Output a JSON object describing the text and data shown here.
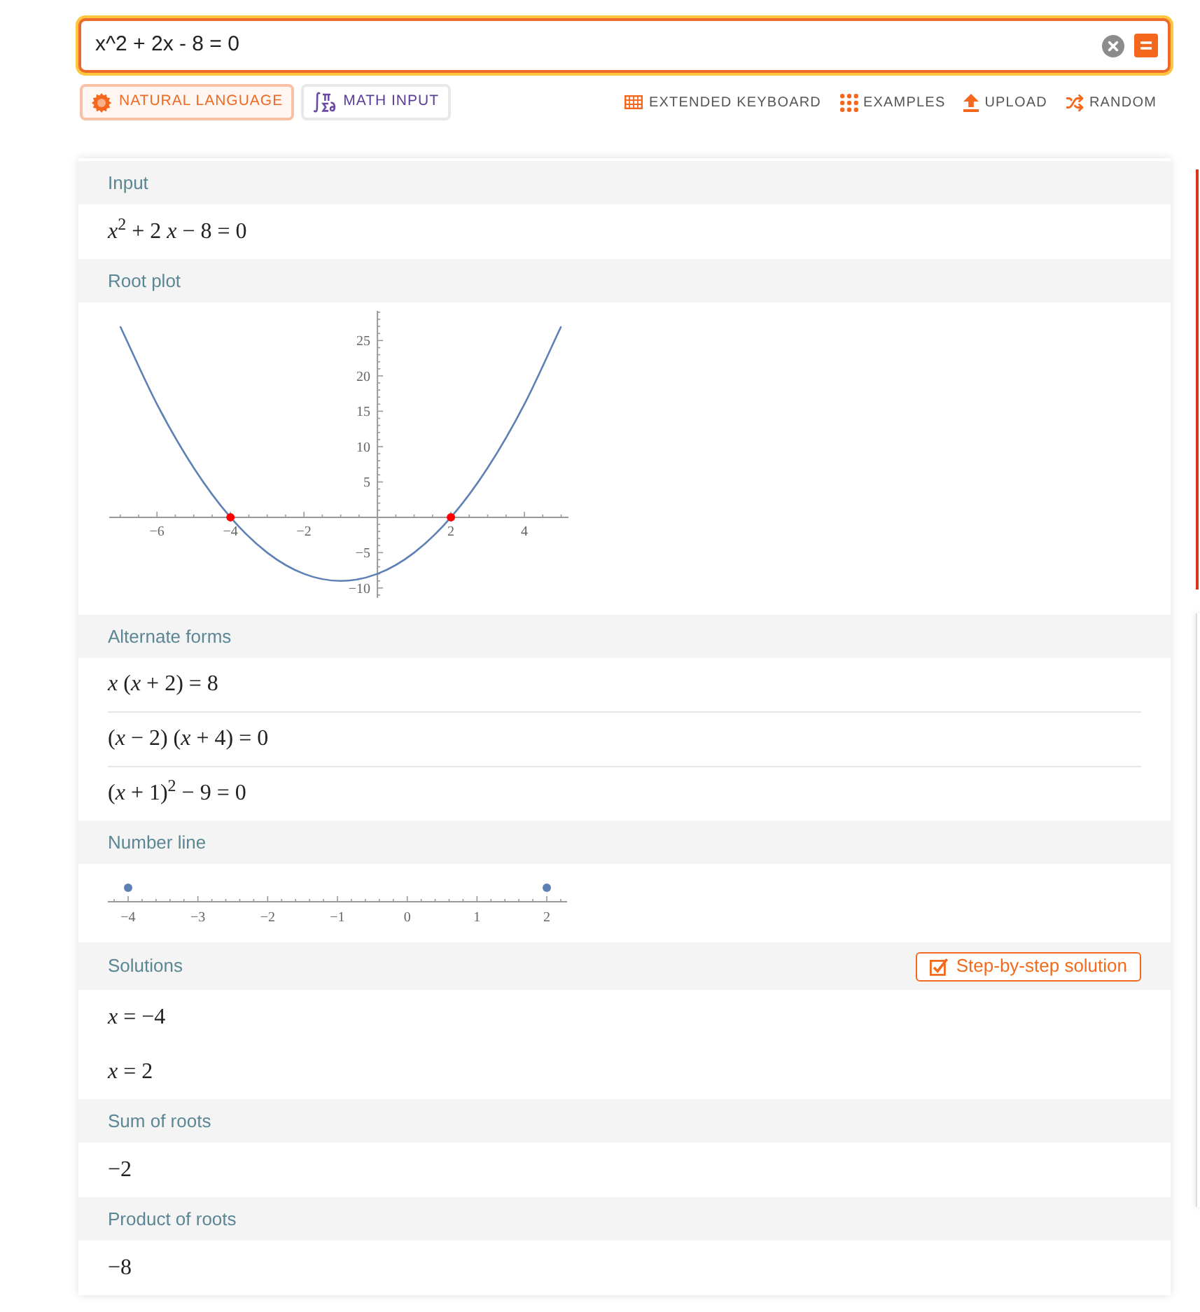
{
  "search": {
    "value": "x^2 + 2x - 8 = 0"
  },
  "input_modes": [
    {
      "label": "NATURAL LANGUAGE",
      "kind": "natural",
      "selected": true
    },
    {
      "label": "MATH INPUT",
      "kind": "math",
      "selected": false
    }
  ],
  "tools": [
    {
      "label": "EXTENDED KEYBOARD",
      "kind": "keyboard"
    },
    {
      "label": "EXAMPLES",
      "kind": "examples"
    },
    {
      "label": "UPLOAD",
      "kind": "upload"
    },
    {
      "label": "RANDOM",
      "kind": "random"
    }
  ],
  "pods": [
    {
      "title": "Input",
      "kind": "math",
      "rows": [
        "*x*$^{2}$ + 2 *x* − 8 = 0"
      ]
    },
    {
      "title": "Root plot",
      "kind": "plot",
      "chart_data": {
        "type": "line",
        "x": [
          -7,
          -6,
          -5,
          -4,
          -3,
          -2,
          -1,
          0,
          1,
          2,
          3,
          4,
          5
        ],
        "series": [
          {
            "color": "#5e81b5",
            "values": [
              27,
              16,
              7,
              0,
              -5,
              -8,
              -9,
              -8,
              -5,
              0,
              7,
              16,
              27
            ]
          }
        ],
        "xlim": [
          -7.3,
          5.2
        ],
        "ylim": [
          -11.4,
          29.2
        ],
        "xticks": [
          {
            "value": -6,
            "label": "−6"
          },
          {
            "value": -4,
            "label": "−4"
          },
          {
            "value": -2,
            "label": "−2"
          },
          2,
          4
        ],
        "yticks": [
          {
            "value": -10,
            "label": "−10"
          },
          {
            "value": -5,
            "label": "−5"
          },
          5,
          10,
          15,
          20,
          25
        ]
      }
    },
    {
      "title": "Alternate forms",
      "kind": "math",
      "divided": true,
      "rows": [
        "*x* (*x* + 2) = 8",
        "(*x* − 2) (*x* + 4) = 0",
        "(*x* + 1)$^{2}$ − 9 = 0"
      ]
    },
    {
      "title": "Number line",
      "kind": "numberline",
      "ticks": [
        {
          "label": "−4",
          "marked": true
        },
        {
          "label": "−3",
          "marked": false
        },
        {
          "label": "−2",
          "marked": false
        },
        {
          "label": "−1",
          "marked": false
        },
        {
          "label": "0",
          "marked": false
        },
        {
          "label": "1",
          "marked": false
        },
        {
          "label": "2",
          "marked": true
        }
      ]
    },
    {
      "title": "Solutions",
      "kind": "math",
      "button": "Step-by-step solution",
      "rows": [
        "*x* = −4",
        "*x* = 2"
      ]
    },
    {
      "title": "Sum of roots",
      "kind": "math",
      "rows": [
        "−2"
      ]
    },
    {
      "title": "Product of roots",
      "kind": "math",
      "rows": [
        "−8"
      ]
    }
  ]
}
